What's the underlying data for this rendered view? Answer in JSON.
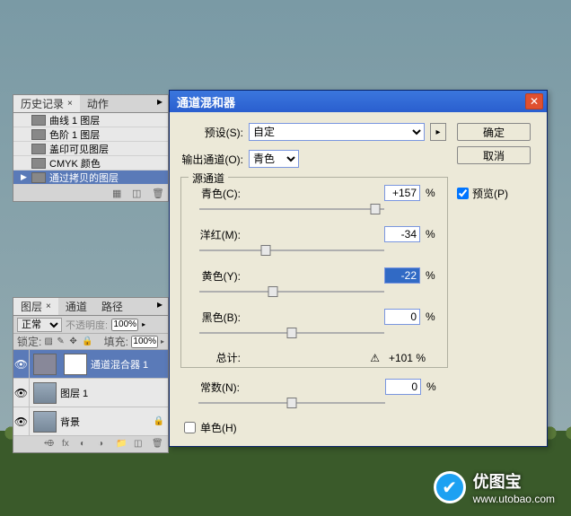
{
  "history": {
    "tabs": [
      {
        "label": "历史记录",
        "active": true
      },
      {
        "label": "动作",
        "active": false
      }
    ],
    "items": [
      {
        "label": "曲线 1 图层",
        "active": false
      },
      {
        "label": "色阶 1 图层",
        "active": false
      },
      {
        "label": "盖印可见图层",
        "active": false
      },
      {
        "label": "CMYK 颜色",
        "active": false
      },
      {
        "label": "通过拷贝的图层",
        "active": true
      }
    ]
  },
  "layers": {
    "tabs": [
      {
        "label": "图层",
        "active": true
      },
      {
        "label": "通道",
        "active": false
      },
      {
        "label": "路径",
        "active": false
      }
    ],
    "blend_label": "正常",
    "opacity_label": "不透明度:",
    "opacity_value": "100%",
    "lock_label": "锁定:",
    "fill_label": "填充:",
    "fill_value": "100%",
    "items": [
      {
        "label": "通道混合器 1",
        "active": true,
        "adjustment": true
      },
      {
        "label": "图层 1",
        "active": false,
        "adjustment": false
      },
      {
        "label": "背景",
        "active": false,
        "adjustment": false,
        "locked": true
      }
    ]
  },
  "dialog": {
    "title": "通道混和器",
    "preset_label": "预设(S):",
    "preset_value": "自定",
    "output_label": "输出通道(O):",
    "output_value": "青色",
    "source_legend": "源通道",
    "ok_label": "确定",
    "cancel_label": "取消",
    "preview_label": "预览(P)",
    "sliders": {
      "cyan": {
        "label": "青色(C):",
        "value": "+157",
        "pos": 95
      },
      "magenta": {
        "label": "洋红(M):",
        "value": "-34",
        "pos": 36
      },
      "yellow": {
        "label": "黄色(Y):",
        "value": "-22",
        "pos": 40,
        "selected": true
      },
      "black": {
        "label": "黑色(B):",
        "value": "0",
        "pos": 50
      }
    },
    "total_label": "总计:",
    "total_value": "+101  %",
    "constant": {
      "label": "常数(N):",
      "value": "0",
      "pos": 50
    },
    "mono_label": "单色(H)"
  },
  "watermark": {
    "brand": "优图宝",
    "url": "www.utobao.com"
  }
}
